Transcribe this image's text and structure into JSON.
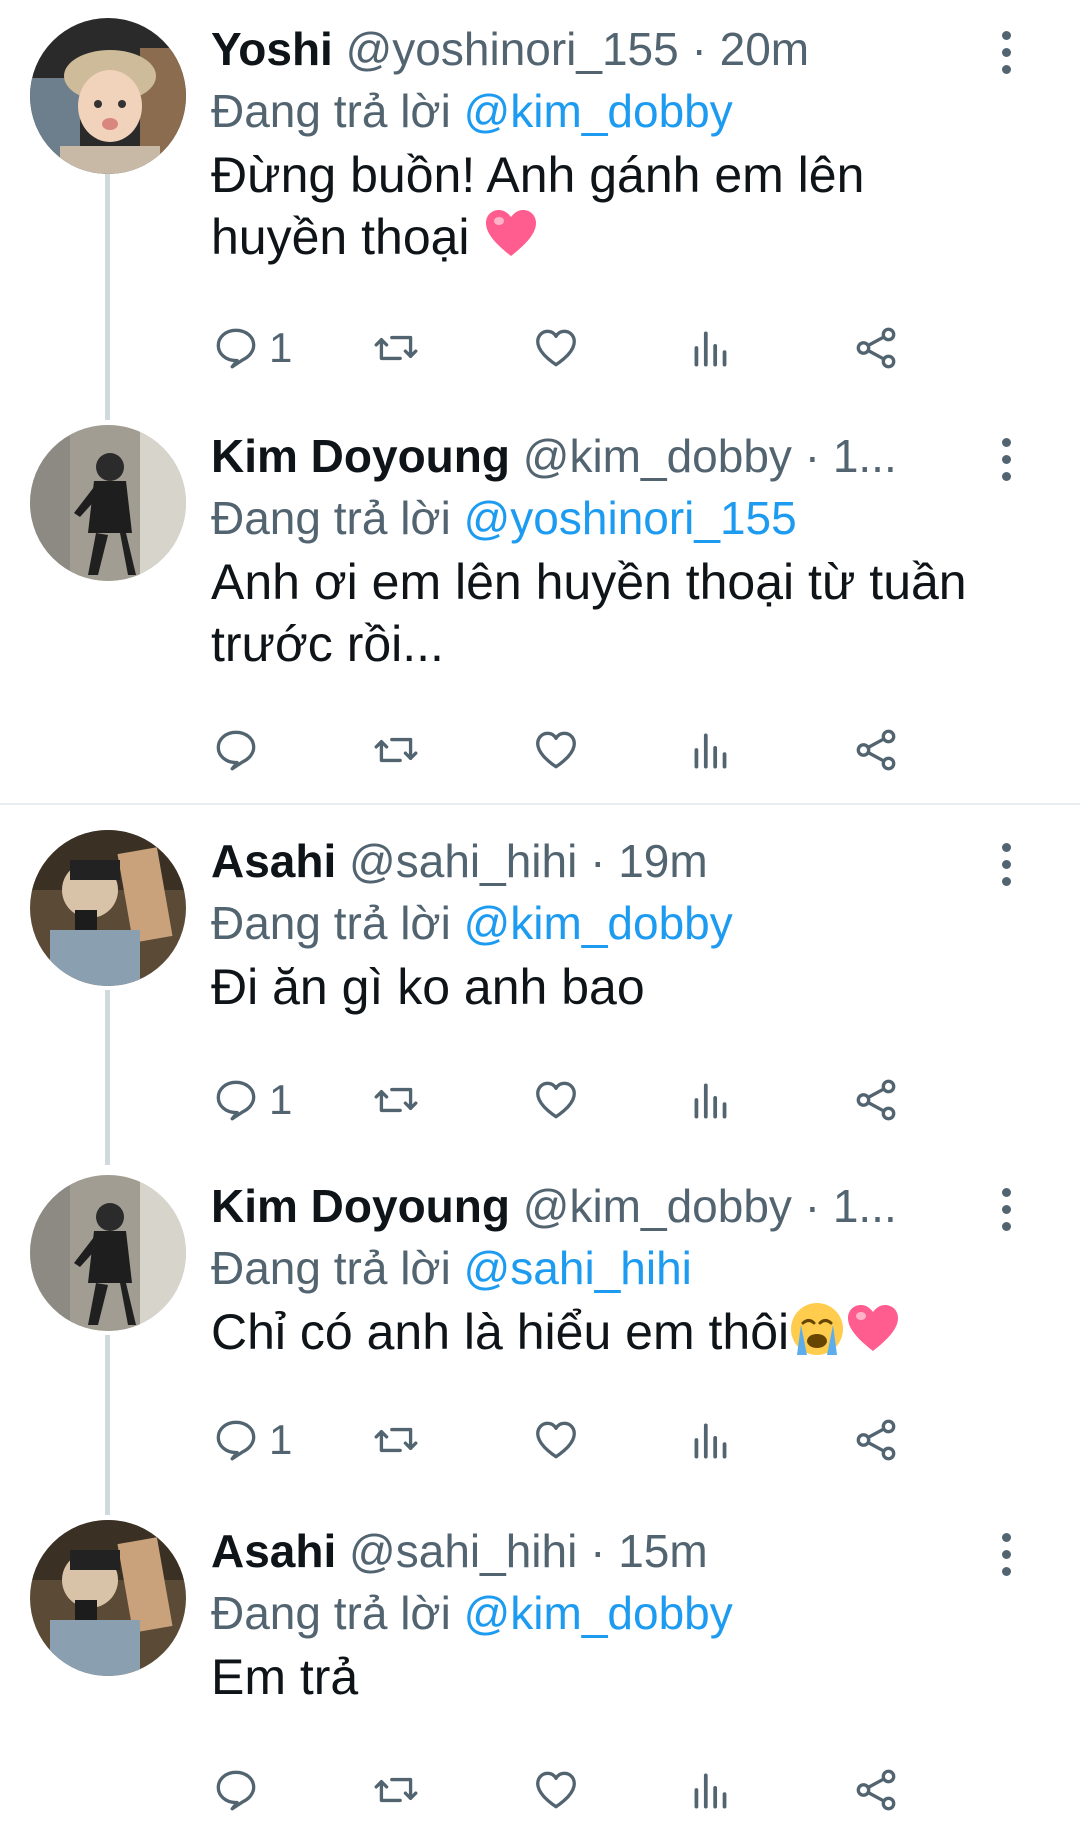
{
  "reply_prefix": "Đang trả lời",
  "tweets": [
    {
      "display_name": "Yoshi",
      "handle": "@yoshinori_155",
      "separator": "·",
      "time": "20m",
      "reply_to": "@kim_dobby",
      "text": "Đừng buồn! Anh gánh em lên huyền thoại",
      "reply_count": "1",
      "avatar_icon": "avatar-photo"
    },
    {
      "display_name": "Kim Doyoung",
      "handle": "@kim_dobby",
      "separator": "·",
      "time": "1...",
      "reply_to": "@yoshinori_155",
      "text": "Anh ơi em lên huyền thoại từ tuần trước rồi...",
      "reply_count": "",
      "avatar_icon": "avatar-photo"
    },
    {
      "display_name": "Asahi",
      "handle": "@sahi_hihi",
      "separator": "·",
      "time": "19m",
      "reply_to": "@kim_dobby",
      "text": "Đi ăn gì ko anh bao",
      "reply_count": "1",
      "avatar_icon": "avatar-photo"
    },
    {
      "display_name": "Kim Doyoung",
      "handle": "@kim_dobby",
      "separator": "·",
      "time": "1...",
      "reply_to": "@sahi_hihi",
      "text": "Chỉ có anh là hiểu em thôi",
      "reply_count": "1",
      "avatar_icon": "avatar-photo"
    },
    {
      "display_name": "Asahi",
      "handle": "@sahi_hihi",
      "separator": "·",
      "time": "15m",
      "reply_to": "@kim_dobby",
      "text": "Em trả",
      "reply_count": "",
      "avatar_icon": "avatar-photo"
    }
  ],
  "icons": {
    "reply": "comment-icon",
    "retweet": "retweet-icon",
    "like": "heart-icon",
    "analytics": "analytics-icon",
    "share": "share-icon",
    "more": "more-vertical-icon"
  },
  "colors": {
    "link": "#1d9bf0",
    "secondary_text": "#536471",
    "thread_line": "#cfd9de",
    "divider": "#e6ecf0",
    "heart_emoji": "#ff5d8f"
  }
}
